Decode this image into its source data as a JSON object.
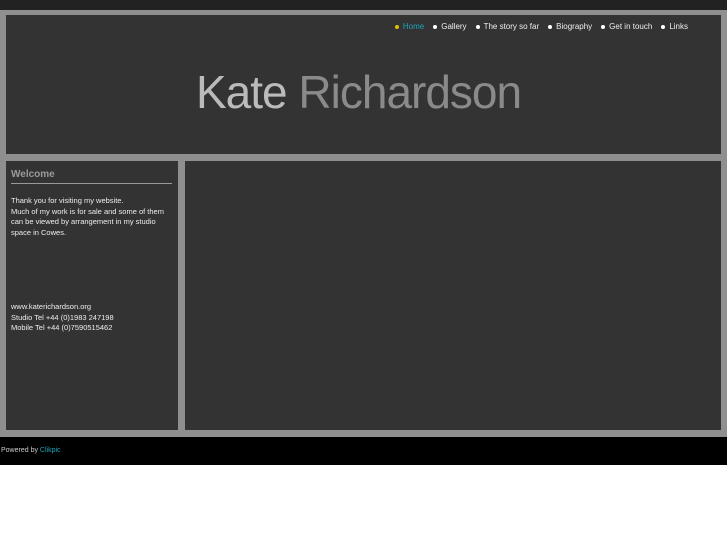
{
  "nav": {
    "items": [
      {
        "label": "Home",
        "active": true
      },
      {
        "label": "Gallery"
      },
      {
        "label": "The story so far"
      },
      {
        "label": "Biography"
      },
      {
        "label": "Get in touch"
      },
      {
        "label": "Links"
      }
    ]
  },
  "header": {
    "first_name": "Kate",
    "last_name": "Richardson"
  },
  "sidebar": {
    "heading": "Welcome",
    "lines": [
      "Thank you for visiting my website.",
      "Much of my work is for sale and some of them",
      "can be viewed by arrangement in my studio",
      "space in Cowes."
    ],
    "contact": [
      "www.katerichardson.org",
      "Studio Tel +44 (0)1983 247198",
      "Mobile Tel +44 (0)7590515462"
    ]
  },
  "footer": {
    "prefix": "Powered by",
    "link": "Clikpic"
  }
}
